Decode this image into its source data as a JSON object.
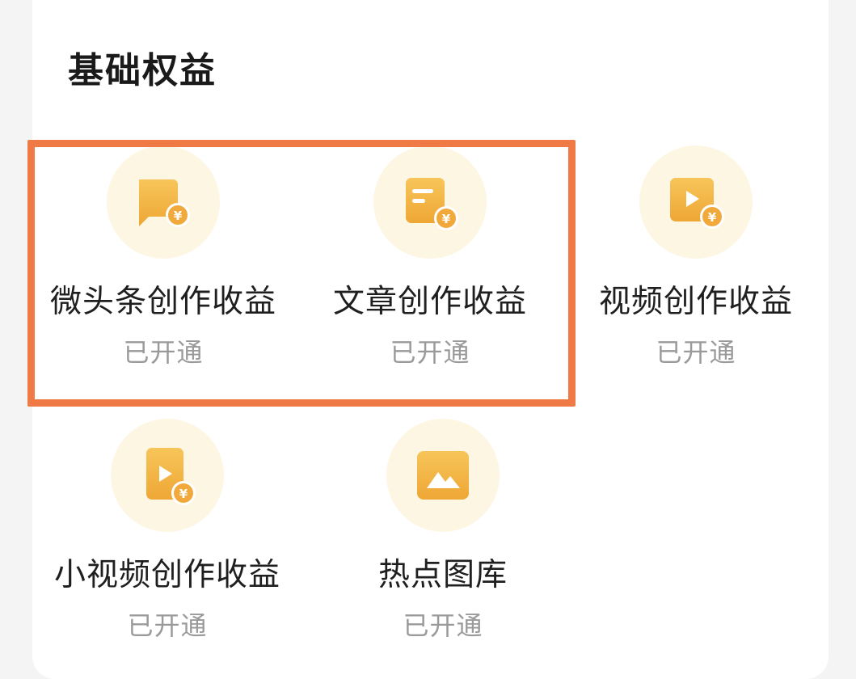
{
  "section": {
    "title": "基础权益"
  },
  "colors": {
    "highlight_border": "#f07a45",
    "icon_bg": "#fdf6e3",
    "icon_gold": "#f2b441",
    "status_gray": "#9a9a9a"
  },
  "benefits": [
    {
      "icon": "chat-bubble-yuan-icon",
      "label": "微头条创作收益",
      "status": "已开通"
    },
    {
      "icon": "document-yuan-icon",
      "label": "文章创作收益",
      "status": "已开通"
    },
    {
      "icon": "video-play-yuan-icon",
      "label": "视频创作收益",
      "status": "已开通"
    },
    {
      "icon": "short-video-yuan-icon",
      "label": "小视频创作收益",
      "status": "已开通"
    },
    {
      "icon": "image-mountain-icon",
      "label": "热点图库",
      "status": "已开通"
    }
  ]
}
